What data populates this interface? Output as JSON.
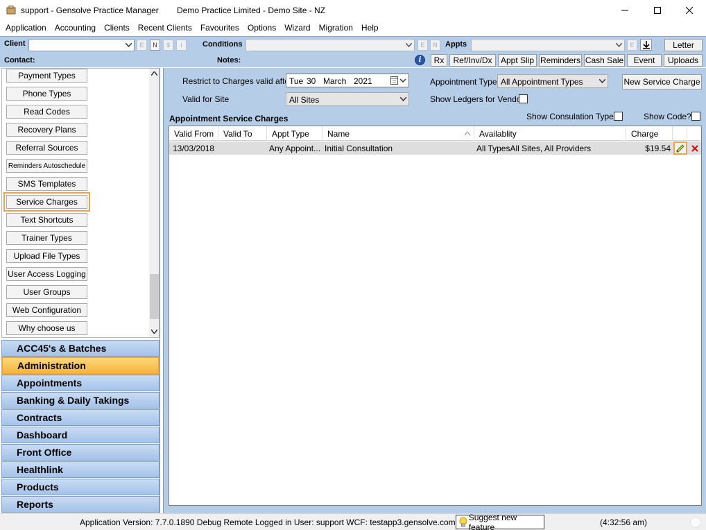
{
  "window": {
    "title": "support - Gensolve Practice Manager",
    "subtitle": "Demo Practice Limited  - Demo Site - NZ"
  },
  "menu": [
    "Application",
    "Accounting",
    "Clients",
    "Recent Clients",
    "Favourites",
    "Options",
    "Wizard",
    "Migration",
    "Help"
  ],
  "clientbar": {
    "client_label": "Client",
    "conditions_label": "Conditions",
    "appts_label": "Appts",
    "contact_label": "Contact:",
    "notes_label": "Notes:",
    "client_btns": [
      "E",
      "N",
      "$",
      "i"
    ],
    "cond_btns": [
      "E",
      "N"
    ],
    "appt_btn": "E",
    "letter": "Letter",
    "info_icon_text": "i",
    "toolbar": [
      "Rx",
      "Ref/Inv/Dx",
      "Appt Slip",
      "Reminders",
      "Cash Sale",
      "Event",
      "Uploads"
    ]
  },
  "sidebar": {
    "items": [
      "Payment Types",
      "Phone Types",
      "Read Codes",
      "Recovery Plans",
      "Referral Sources",
      "Reminders Autoschedule",
      "SMS Templates",
      "Service Charges",
      "Text Shortcuts",
      "Trainer Types",
      "Upload File Types",
      "User Access Logging",
      "User Groups",
      "Web Configuration",
      "Why choose us"
    ],
    "nav": [
      "ACC45's & Batches",
      "Administration",
      "Appointments",
      "Banking & Daily Takings",
      "Contracts",
      "Dashboard",
      "Front Office",
      "Healthlink",
      "Products",
      "Reports"
    ]
  },
  "filters": {
    "restrict_label": "Restrict to Charges valid after",
    "date_day": "Tue",
    "date_num": "30",
    "date_month": "March",
    "date_year": "2021",
    "site_label": "Valid for Site",
    "site_value": "All Sites",
    "appt_type_label": "Appointment Type",
    "appt_type_value": "All Appointment Types",
    "new_btn": "New Service Charge",
    "show_ledgers_label": "Show Ledgers for Vendor",
    "section_title": "Appointment Service Charges",
    "show_consult_label": "Show Consulation Type?",
    "show_code_label": "Show Code?"
  },
  "grid": {
    "columns": [
      "Valid From",
      "Valid To",
      "Appt Type",
      "Name",
      "Availablity",
      "Charge"
    ],
    "rows": [
      {
        "valid_from": "13/03/2018",
        "valid_to": "",
        "appt_type": "Any Appoint...",
        "name": "Initial Consultation",
        "availability": "All TypesAll Sites, All Providers",
        "charge": "$19.54"
      }
    ]
  },
  "status": {
    "version": "Application Version: 7.7.0.1890 Debug Remote  Logged in User: support WCF: testapp3.gensolve.com:4551",
    "suggest": "Suggest new feature",
    "time": "(4:32:56 am)"
  },
  "colors": {
    "accent": "#f0a24a",
    "panel": "#b6cde8",
    "nav": "#a4c2e9"
  }
}
